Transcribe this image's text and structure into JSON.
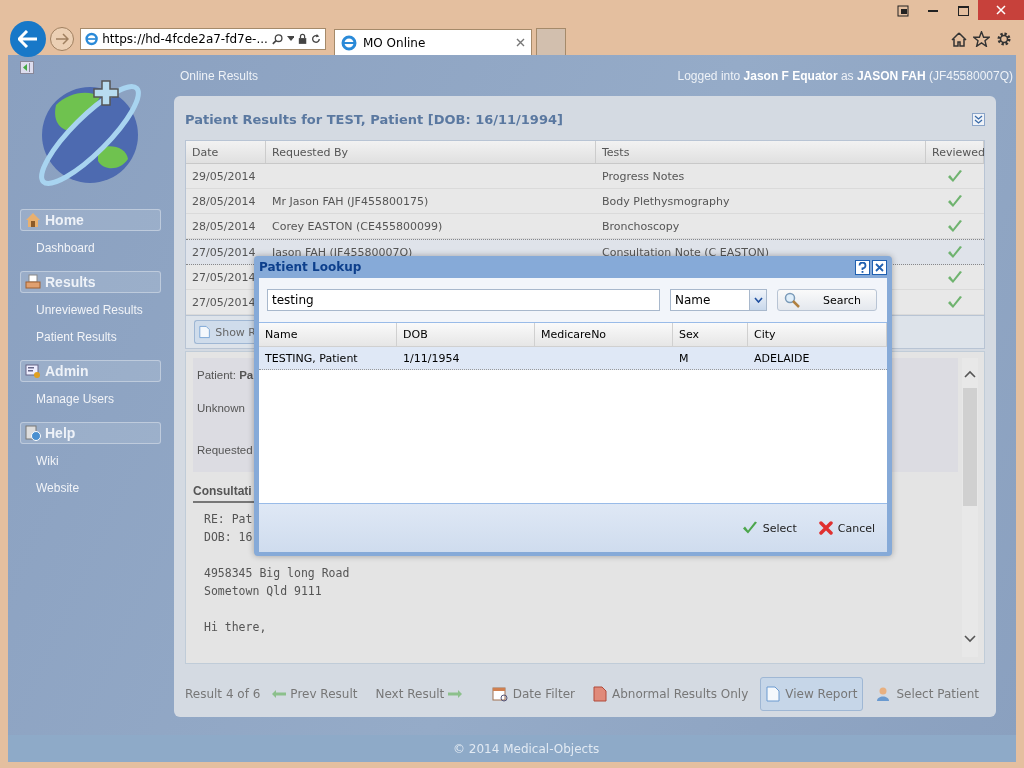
{
  "browser": {
    "address": "https://hd-4fcde2a7-fd7e-...",
    "tab_title": "MO Online"
  },
  "header": {
    "section": "Online Results",
    "login": "Logged into **Jason F Equator** as **JASON FAH** (JF45580007Q)"
  },
  "sidebar": {
    "groups": [
      {
        "title": "Home",
        "kind": "home",
        "items": [
          "Dashboard"
        ]
      },
      {
        "title": "Results",
        "kind": "printer",
        "items": [
          "Unreviewed Results",
          "Patient Results"
        ]
      },
      {
        "title": "Admin",
        "kind": "admin",
        "items": [
          "Manage Users"
        ]
      },
      {
        "title": "Help",
        "kind": "help",
        "items": [
          "Wiki",
          "Website"
        ]
      }
    ]
  },
  "panel": {
    "title": "Patient Results for TEST, Patient [DOB: 16/11/1994]",
    "table": {
      "columns": [
        "Date",
        "Requested By",
        "Tests",
        "Reviewed"
      ],
      "rows": [
        {
          "date": "29/05/2014",
          "tests": "Progress Notes",
          "reviewed": true,
          "selected": false
        },
        {
          "date": "28/05/2014",
          "requested_by": "Mr Jason FAH (JF455800175)",
          "tests": "Body Plethysmography",
          "reviewed": true,
          "selected": false
        },
        {
          "date": "28/05/2014",
          "requested_by": "Corey EASTON (CE455800099)",
          "tests": "Bronchoscopy",
          "reviewed": true,
          "selected": false
        },
        {
          "date": "27/05/2014",
          "requested_by": "Jason FAH (JF45580007Q)",
          "tests": "Consultation Note (C EASTON)",
          "reviewed": true,
          "selected": true
        },
        {
          "date": "27/05/2014",
          "reviewed": true,
          "selected": false
        },
        {
          "date": "27/05/2014",
          "reviewed": true,
          "selected": false
        }
      ]
    },
    "show_button": "Show R",
    "detail": {
      "patient": "Patient: **Pa**",
      "status": "Unknown",
      "requested": "Requested",
      "section": "Consultati",
      "letter": [
        [
          "RE: Pat",
          "DOB: 16"
        ],
        [
          "4958345 Big long Road",
          "Sometown Qld 9111"
        ],
        [
          "Hi there,"
        ]
      ]
    },
    "footer": {
      "count": "Result 4 of 6",
      "prev": "Prev Result",
      "next": "Next Result",
      "actions": [
        {
          "label": "Date Filter",
          "kind": "calendar",
          "selected": false
        },
        {
          "label": "Abnormal Results Only",
          "kind": "report-red",
          "selected": false
        },
        {
          "label": "View Report",
          "kind": "report",
          "selected": true
        },
        {
          "label": "Select Patient",
          "kind": "person",
          "selected": false
        }
      ]
    }
  },
  "copyright": "© 2014 Medical-Objects",
  "dialog": {
    "title": "Patient Lookup",
    "search_value": "testing",
    "search_by": "Name",
    "search_button": "Search",
    "columns": [
      "Name",
      "DOB",
      "MedicareNo",
      "Sex",
      "City"
    ],
    "rows": [
      {
        "cells": [
          "TESTING, Patient",
          "1/11/1954",
          "",
          "M",
          "ADELAIDE"
        ],
        "selected": true
      }
    ],
    "buttons": [
      {
        "label": "Select",
        "kind": "ok"
      },
      {
        "label": "Cancel",
        "kind": "cancel"
      }
    ]
  }
}
